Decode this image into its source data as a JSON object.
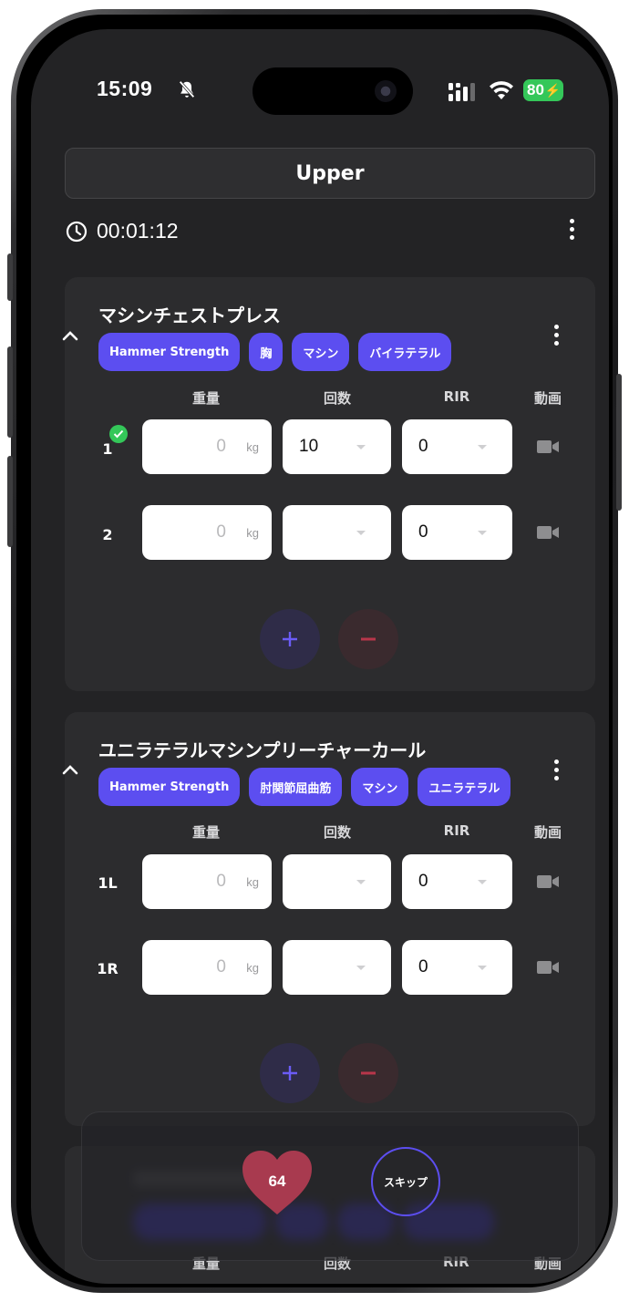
{
  "status_bar": {
    "time": "15:09",
    "battery": "80"
  },
  "header": {
    "title": "Upper"
  },
  "timer": {
    "elapsed": "00:01:12"
  },
  "columns": {
    "weight": "重量",
    "reps": "回数",
    "rir": "RIR",
    "video": "動画"
  },
  "exercises": [
    {
      "name": "マシンチェストプレス",
      "tags": [
        "Hammer Strength",
        "胸",
        "マシン",
        "バイラテラル"
      ],
      "sets": [
        {
          "label": "1",
          "completed": true,
          "weight_placeholder": "0",
          "unit": "kg",
          "reps": "10",
          "rir": "0"
        },
        {
          "label": "2",
          "completed": false,
          "weight_placeholder": "0",
          "unit": "kg",
          "reps": "",
          "rir": "0"
        }
      ]
    },
    {
      "name": "ユニラテラルマシンプリーチャーカール",
      "tags": [
        "Hammer Strength",
        "肘関節屈曲筋",
        "マシン",
        "ユニラテラル"
      ],
      "sets": [
        {
          "label": "1L",
          "completed": false,
          "weight_placeholder": "0",
          "unit": "kg",
          "reps": "",
          "rir": "0"
        },
        {
          "label": "1R",
          "completed": false,
          "weight_placeholder": "0",
          "unit": "kg",
          "reps": "",
          "rir": "0"
        }
      ]
    }
  ],
  "rest_panel": {
    "heart_rate": "64",
    "skip_label": "スキップ"
  },
  "colors": {
    "accent": "#5c4ef0",
    "background": "#232325",
    "card": "#2c2c2e",
    "heart": "#a83a4f",
    "check": "#34c759"
  }
}
